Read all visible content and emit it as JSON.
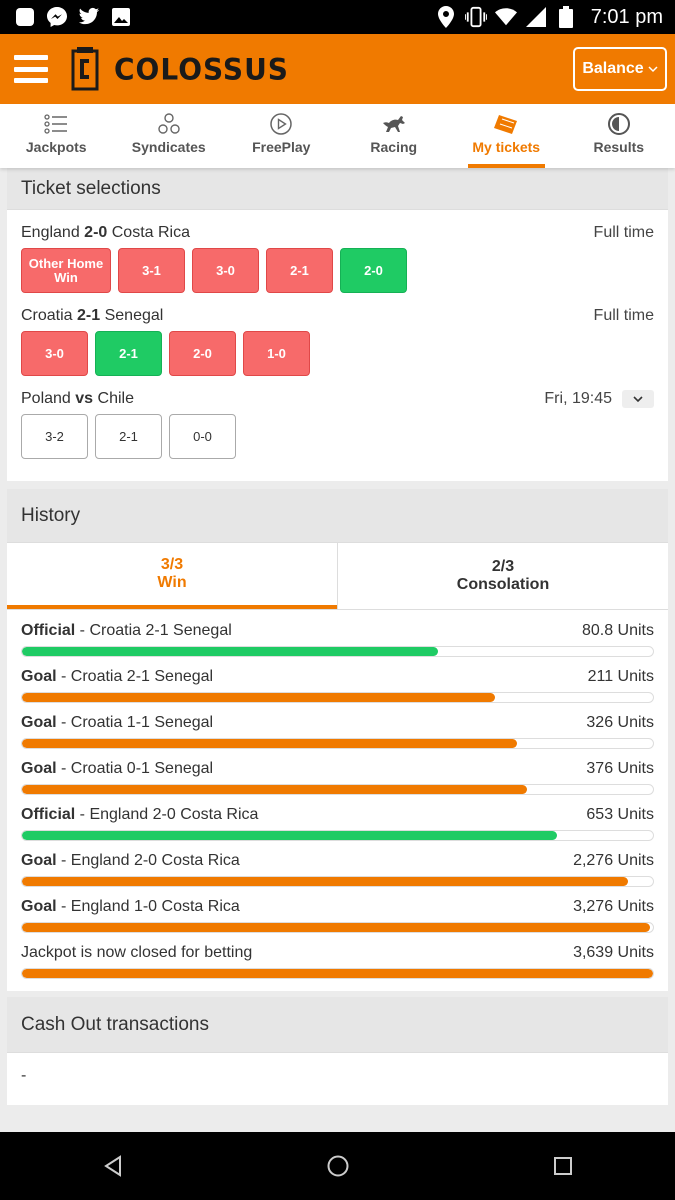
{
  "status_bar": {
    "time": "7:01 pm",
    "icons": [
      "notification-square-icon",
      "messenger-icon",
      "twitter-icon",
      "image-icon",
      "location-icon",
      "vibrate-icon",
      "wifi-icon",
      "signal-icon",
      "battery-icon"
    ]
  },
  "header": {
    "brand": "COLOSSUS",
    "logo_letter": "C",
    "balance_label": "Balance",
    "accent_color": "#f07a00"
  },
  "tabs": [
    {
      "label": "Jackpots",
      "icon": "list-icon",
      "active": false
    },
    {
      "label": "Syndicates",
      "icon": "syndicate-icon",
      "active": false
    },
    {
      "label": "FreePlay",
      "icon": "play-icon",
      "active": false
    },
    {
      "label": "Racing",
      "icon": "horse-icon",
      "active": false
    },
    {
      "label": "My tickets",
      "icon": "ticket-icon",
      "active": true
    },
    {
      "label": "Results",
      "icon": "results-icon",
      "active": false
    }
  ],
  "ticket_selections": {
    "title": "Ticket selections",
    "matches": [
      {
        "home": "England",
        "score": "2-0",
        "away": "Costa Rica",
        "separator": "",
        "status": "Full time",
        "picks": [
          {
            "label": "Other Home Win",
            "state": "lost"
          },
          {
            "label": "3-1",
            "state": "lost"
          },
          {
            "label": "3-0",
            "state": "lost"
          },
          {
            "label": "2-1",
            "state": "lost"
          },
          {
            "label": "2-0",
            "state": "won"
          }
        ]
      },
      {
        "home": "Croatia",
        "score": "2-1",
        "away": "Senegal",
        "status": "Full time",
        "picks": [
          {
            "label": "3-0",
            "state": "lost"
          },
          {
            "label": "2-1",
            "state": "won"
          },
          {
            "label": "2-0",
            "state": "lost"
          },
          {
            "label": "1-0",
            "state": "lost"
          }
        ]
      },
      {
        "home": "Poland",
        "score": "vs",
        "away": "Chile",
        "status": "Fri, 19:45",
        "picks": [
          {
            "label": "3-2",
            "state": "pending"
          },
          {
            "label": "2-1",
            "state": "pending"
          },
          {
            "label": "0-0",
            "state": "pending"
          }
        ]
      }
    ]
  },
  "history": {
    "title": "History",
    "tabs": [
      {
        "line1": "3/3",
        "line2": "Win",
        "active": true
      },
      {
        "line1": "2/3",
        "line2": "Consolation",
        "active": false
      }
    ],
    "rows": [
      {
        "type": "Official",
        "text": "Croatia 2-1 Senegal",
        "value": "80.8 Units",
        "progress": 0.66,
        "color": "#1fcb64"
      },
      {
        "type": "Goal",
        "text": "Croatia 2-1 Senegal",
        "value": "211 Units",
        "progress": 0.75,
        "color": "#f07a00"
      },
      {
        "type": "Goal",
        "text": "Croatia 1-1 Senegal",
        "value": "326 Units",
        "progress": 0.785,
        "color": "#f07a00"
      },
      {
        "type": "Goal",
        "text": "Croatia 0-1 Senegal",
        "value": "376 Units",
        "progress": 0.8,
        "color": "#f07a00"
      },
      {
        "type": "Official",
        "text": "England 2-0 Costa Rica",
        "value": "653 Units",
        "progress": 0.848,
        "color": "#1fcb64"
      },
      {
        "type": "Goal",
        "text": "England 2-0 Costa Rica",
        "value": "2,276 Units",
        "progress": 0.96,
        "color": "#f07a00"
      },
      {
        "type": "Goal",
        "text": "England 1-0 Costa Rica",
        "value": "3,276 Units",
        "progress": 0.995,
        "color": "#f07a00"
      },
      {
        "type": "",
        "text": "Jackpot is now closed for betting",
        "value": "3,639 Units",
        "progress": 1.0,
        "color": "#f07a00"
      }
    ]
  },
  "cash_out": {
    "title": "Cash Out transactions",
    "value": "-"
  },
  "colors": {
    "lost": "#f76a6a",
    "won": "#1fcb64",
    "accent": "#f07a00"
  }
}
